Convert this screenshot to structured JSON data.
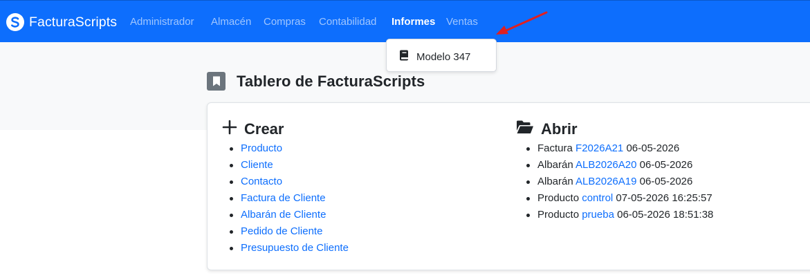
{
  "brand": {
    "name": "FacturaScripts"
  },
  "nav": {
    "items": [
      {
        "label": "Administrador"
      },
      {
        "label": "Almacén"
      },
      {
        "label": "Compras"
      },
      {
        "label": "Contabilidad"
      },
      {
        "label": "Informes",
        "active": true
      },
      {
        "label": "Ventas"
      }
    ]
  },
  "dropdown": {
    "items": [
      {
        "label": "Modelo 347",
        "icon": "book-icon"
      }
    ]
  },
  "page": {
    "title": "Tablero de FacturaScripts",
    "title_icon": "bookmark-icon"
  },
  "create": {
    "heading": "Crear",
    "icon": "plus-icon",
    "items": [
      "Producto",
      "Cliente",
      "Contacto",
      "Factura de Cliente",
      "Albarán de Cliente",
      "Pedido de Cliente",
      "Presupuesto de Cliente"
    ]
  },
  "open": {
    "heading": "Abrir",
    "icon": "folder-open-icon",
    "items": [
      {
        "type": "Factura",
        "code": "F2026A21",
        "date": "06-05-2026"
      },
      {
        "type": "Albarán",
        "code": "ALB2026A20",
        "date": "06-05-2026"
      },
      {
        "type": "Albarán",
        "code": "ALB2026A19",
        "date": "06-05-2026"
      },
      {
        "type": "Producto",
        "code": "control",
        "date": "07-05-2026 16:25:57"
      },
      {
        "type": "Producto",
        "code": "prueba",
        "date": "06-05-2026 18:51:38"
      }
    ]
  },
  "colors": {
    "navbar": "#0d6efd",
    "link": "#0d6efd",
    "annotation_arrow": "#e02020"
  }
}
